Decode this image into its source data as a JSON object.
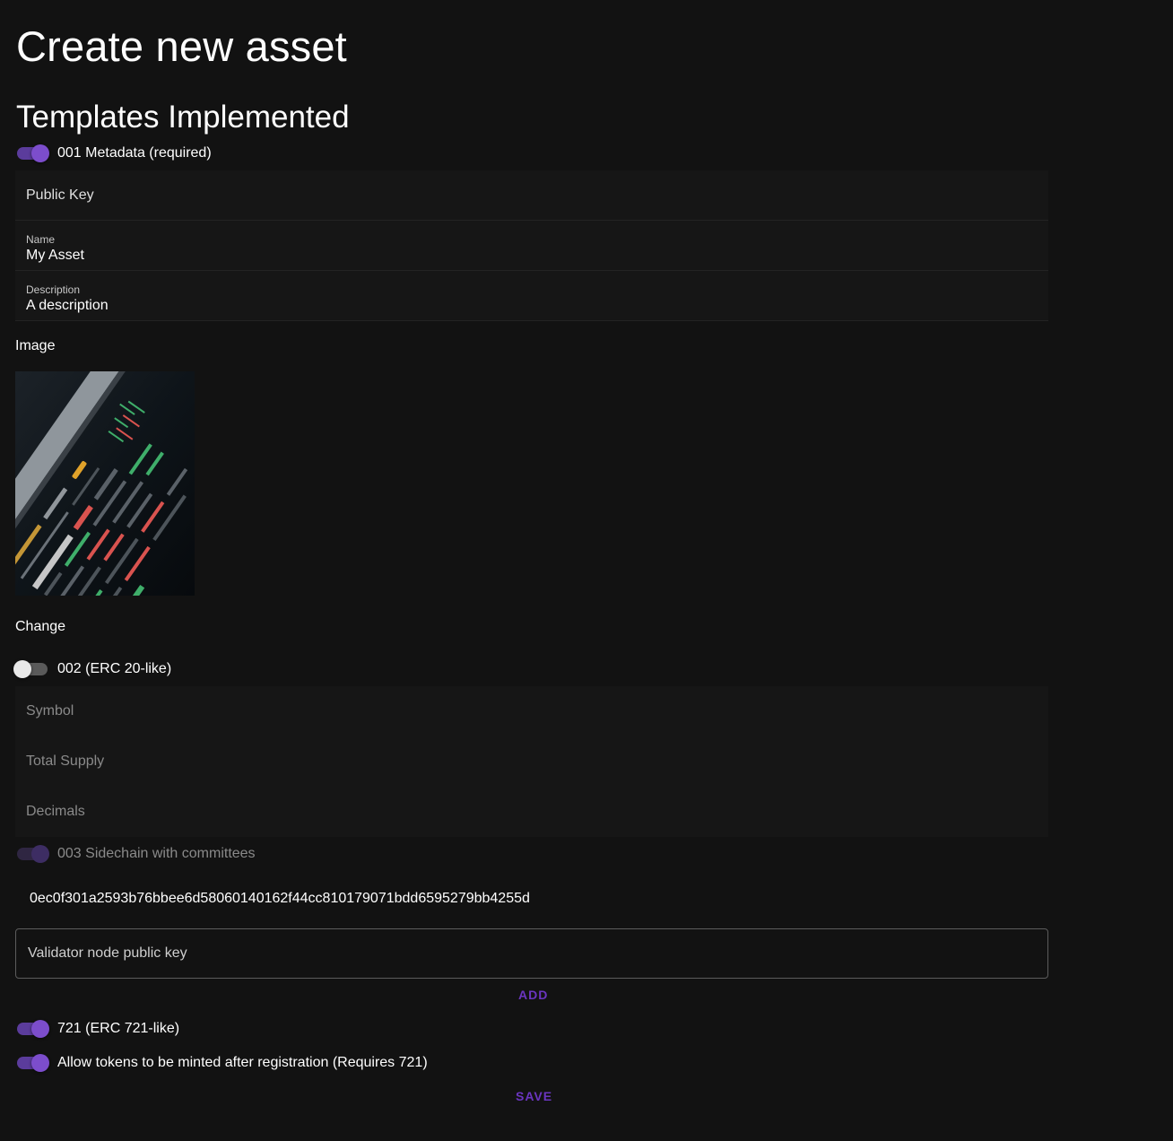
{
  "page": {
    "title": "Create new asset",
    "subtitle": "Templates Implemented"
  },
  "template_001": {
    "label": "001 Metadata (required)",
    "enabled": true,
    "public_key_placeholder": "Public Key",
    "name_label": "Name",
    "name_value": "My Asset",
    "description_label": "Description",
    "description_value": "A description",
    "image_label": "Image",
    "change_label": "Change"
  },
  "template_002": {
    "label": "002 (ERC 20-like)",
    "enabled": false,
    "symbol_placeholder": "Symbol",
    "total_supply_placeholder": "Total Supply",
    "decimals_placeholder": "Decimals"
  },
  "template_003": {
    "label": "003 Sidechain with committees",
    "enabled": true,
    "disabled": true,
    "committee_key": "0ec0f301a2593b76bbee6d58060140162f44cc810179071bdd6595279bb4255d",
    "validator_placeholder": "Validator node public key",
    "add_label": "ADD"
  },
  "template_721": {
    "label": "721 (ERC 721-like)",
    "enabled": true
  },
  "mint_after_registration": {
    "label": "Allow tokens to be minted after registration (Requires 721)",
    "enabled": true
  },
  "save_label": "SAVE",
  "colors": {
    "background": "#121212",
    "accent": "#7c4dcc",
    "button_text": "#6a35c0"
  }
}
